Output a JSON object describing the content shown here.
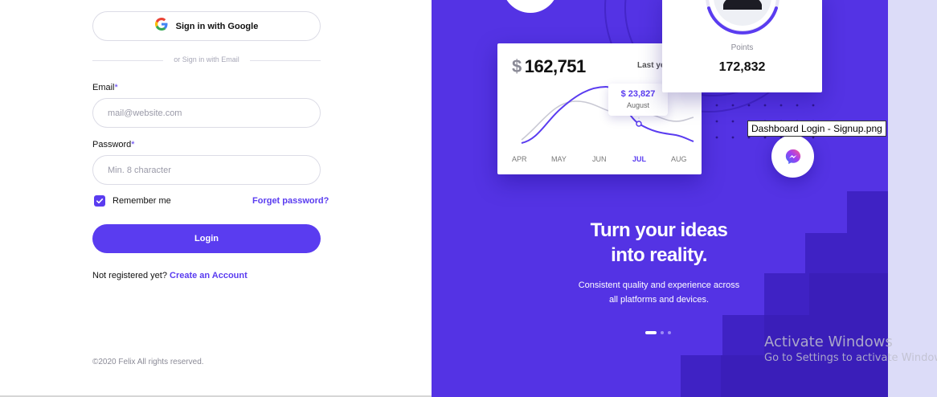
{
  "login": {
    "google_button": "Sign in with Google",
    "divider_text": "or Sign in with Email",
    "email_label": "Email",
    "email_placeholder": "mail@website.com",
    "password_label": "Password",
    "password_placeholder": "Min. 8 character",
    "required_marker": "*",
    "remember_label": "Remember me",
    "remember_checked": true,
    "forget_link": "Forget password?",
    "login_button": "Login",
    "register_prompt": "Not registered yet?",
    "register_link": "Create an Account",
    "copyright": "©2020 Felix All rights reserved."
  },
  "showcase": {
    "revenue_currency": "$",
    "revenue_value": "162,751",
    "revenue_period": "Last year",
    "tooltip_value": "$ 23,827",
    "tooltip_month": "August",
    "months": [
      "APR",
      "MAY",
      "JUN",
      "JUL",
      "AUG"
    ],
    "active_month": "JUL",
    "points_label": "Points",
    "points_value": "172,832",
    "headline_line1": "Turn your ideas",
    "headline_line2": "into reality.",
    "subtext_line1": "Consistent quality and experience across",
    "subtext_line2": "all platforms and devices.",
    "pager_active": 0,
    "pager_count": 3
  },
  "overlay": {
    "file_tooltip": "Dashboard Login - Signup.png",
    "activate_title": "Activate Windows",
    "activate_sub": "Go to Settings to activate Windows."
  },
  "colors": {
    "accent": "#5a3cf0",
    "panel": "#5433e4",
    "panel_dark": "#3f22c4"
  }
}
